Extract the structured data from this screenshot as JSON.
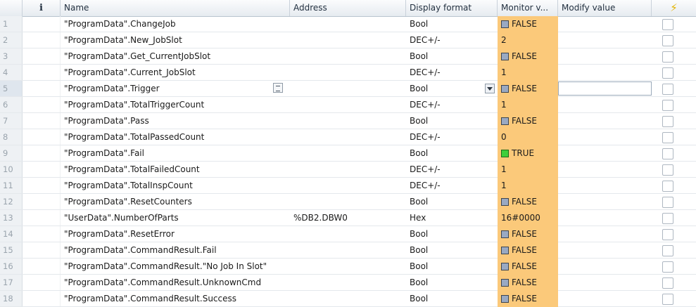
{
  "columns": {
    "info": "i",
    "name": "Name",
    "address": "Address",
    "display_format": "Display format",
    "monitor_value": "Monitor v...",
    "modify_value": "Modify value",
    "modify_flag": "⚡"
  },
  "rows": [
    {
      "num": "1",
      "name": "\"ProgramData\".ChangeJob",
      "address": "",
      "format": "Bool",
      "monitor": "FALSE",
      "bool": true,
      "on": false
    },
    {
      "num": "2",
      "name": "\"ProgramData\".New_JobSlot",
      "address": "",
      "format": "DEC+/-",
      "monitor": "2",
      "bool": false,
      "on": false
    },
    {
      "num": "3",
      "name": "\"ProgramData\".Get_CurrentJobSlot",
      "address": "",
      "format": "Bool",
      "monitor": "FALSE",
      "bool": true,
      "on": false
    },
    {
      "num": "4",
      "name": "\"ProgramData\".Current_JobSlot",
      "address": "",
      "format": "DEC+/-",
      "monitor": "1",
      "bool": false,
      "on": false
    },
    {
      "num": "5",
      "name": "\"ProgramData\".Trigger",
      "address": "",
      "format": "Bool",
      "monitor": "FALSE",
      "bool": true,
      "on": false
    },
    {
      "num": "6",
      "name": "\"ProgramData\".TotalTriggerCount",
      "address": "",
      "format": "DEC+/-",
      "monitor": "1",
      "bool": false,
      "on": false
    },
    {
      "num": "7",
      "name": "\"ProgramData\".Pass",
      "address": "",
      "format": "Bool",
      "monitor": "FALSE",
      "bool": true,
      "on": false
    },
    {
      "num": "8",
      "name": "\"ProgramData\".TotalPassedCount",
      "address": "",
      "format": "DEC+/-",
      "monitor": "0",
      "bool": false,
      "on": false
    },
    {
      "num": "9",
      "name": "\"ProgramData\".Fail",
      "address": "",
      "format": "Bool",
      "monitor": "TRUE",
      "bool": true,
      "on": true
    },
    {
      "num": "10",
      "name": "\"ProgramData\".TotalFailedCount",
      "address": "",
      "format": "DEC+/-",
      "monitor": "1",
      "bool": false,
      "on": false
    },
    {
      "num": "11",
      "name": "\"ProgramData\".TotalInspCount",
      "address": "",
      "format": "DEC+/-",
      "monitor": "1",
      "bool": false,
      "on": false
    },
    {
      "num": "12",
      "name": "\"ProgramData\".ResetCounters",
      "address": "",
      "format": "Bool",
      "monitor": "FALSE",
      "bool": true,
      "on": false
    },
    {
      "num": "13",
      "name": "\"UserData\".NumberOfParts",
      "address": "%DB2.DBW0",
      "format": "Hex",
      "monitor": "16#0000",
      "bool": false,
      "on": false
    },
    {
      "num": "14",
      "name": "\"ProgramData\".ResetError",
      "address": "",
      "format": "Bool",
      "monitor": "FALSE",
      "bool": true,
      "on": false
    },
    {
      "num": "15",
      "name": "\"ProgramData\".CommandResult.Fail",
      "address": "",
      "format": "Bool",
      "monitor": "FALSE",
      "bool": true,
      "on": false
    },
    {
      "num": "16",
      "name": "\"ProgramData\".CommandResult.\"No Job In Slot\"",
      "address": "",
      "format": "Bool",
      "monitor": "FALSE",
      "bool": true,
      "on": false
    },
    {
      "num": "17",
      "name": "\"ProgramData\".CommandResult.UnknownCmd",
      "address": "",
      "format": "Bool",
      "monitor": "FALSE",
      "bool": true,
      "on": false
    },
    {
      "num": "18",
      "name": "\"ProgramData\".CommandResult.Success",
      "address": "",
      "format": "Bool",
      "monitor": "FALSE",
      "bool": true,
      "on": false
    }
  ],
  "selected_row": "5",
  "colors": {
    "monitor_bg": "#fbc97a",
    "bool_false": "#9aa9c2",
    "bool_true": "#3fcf3a",
    "bolt": "#e2b400"
  }
}
